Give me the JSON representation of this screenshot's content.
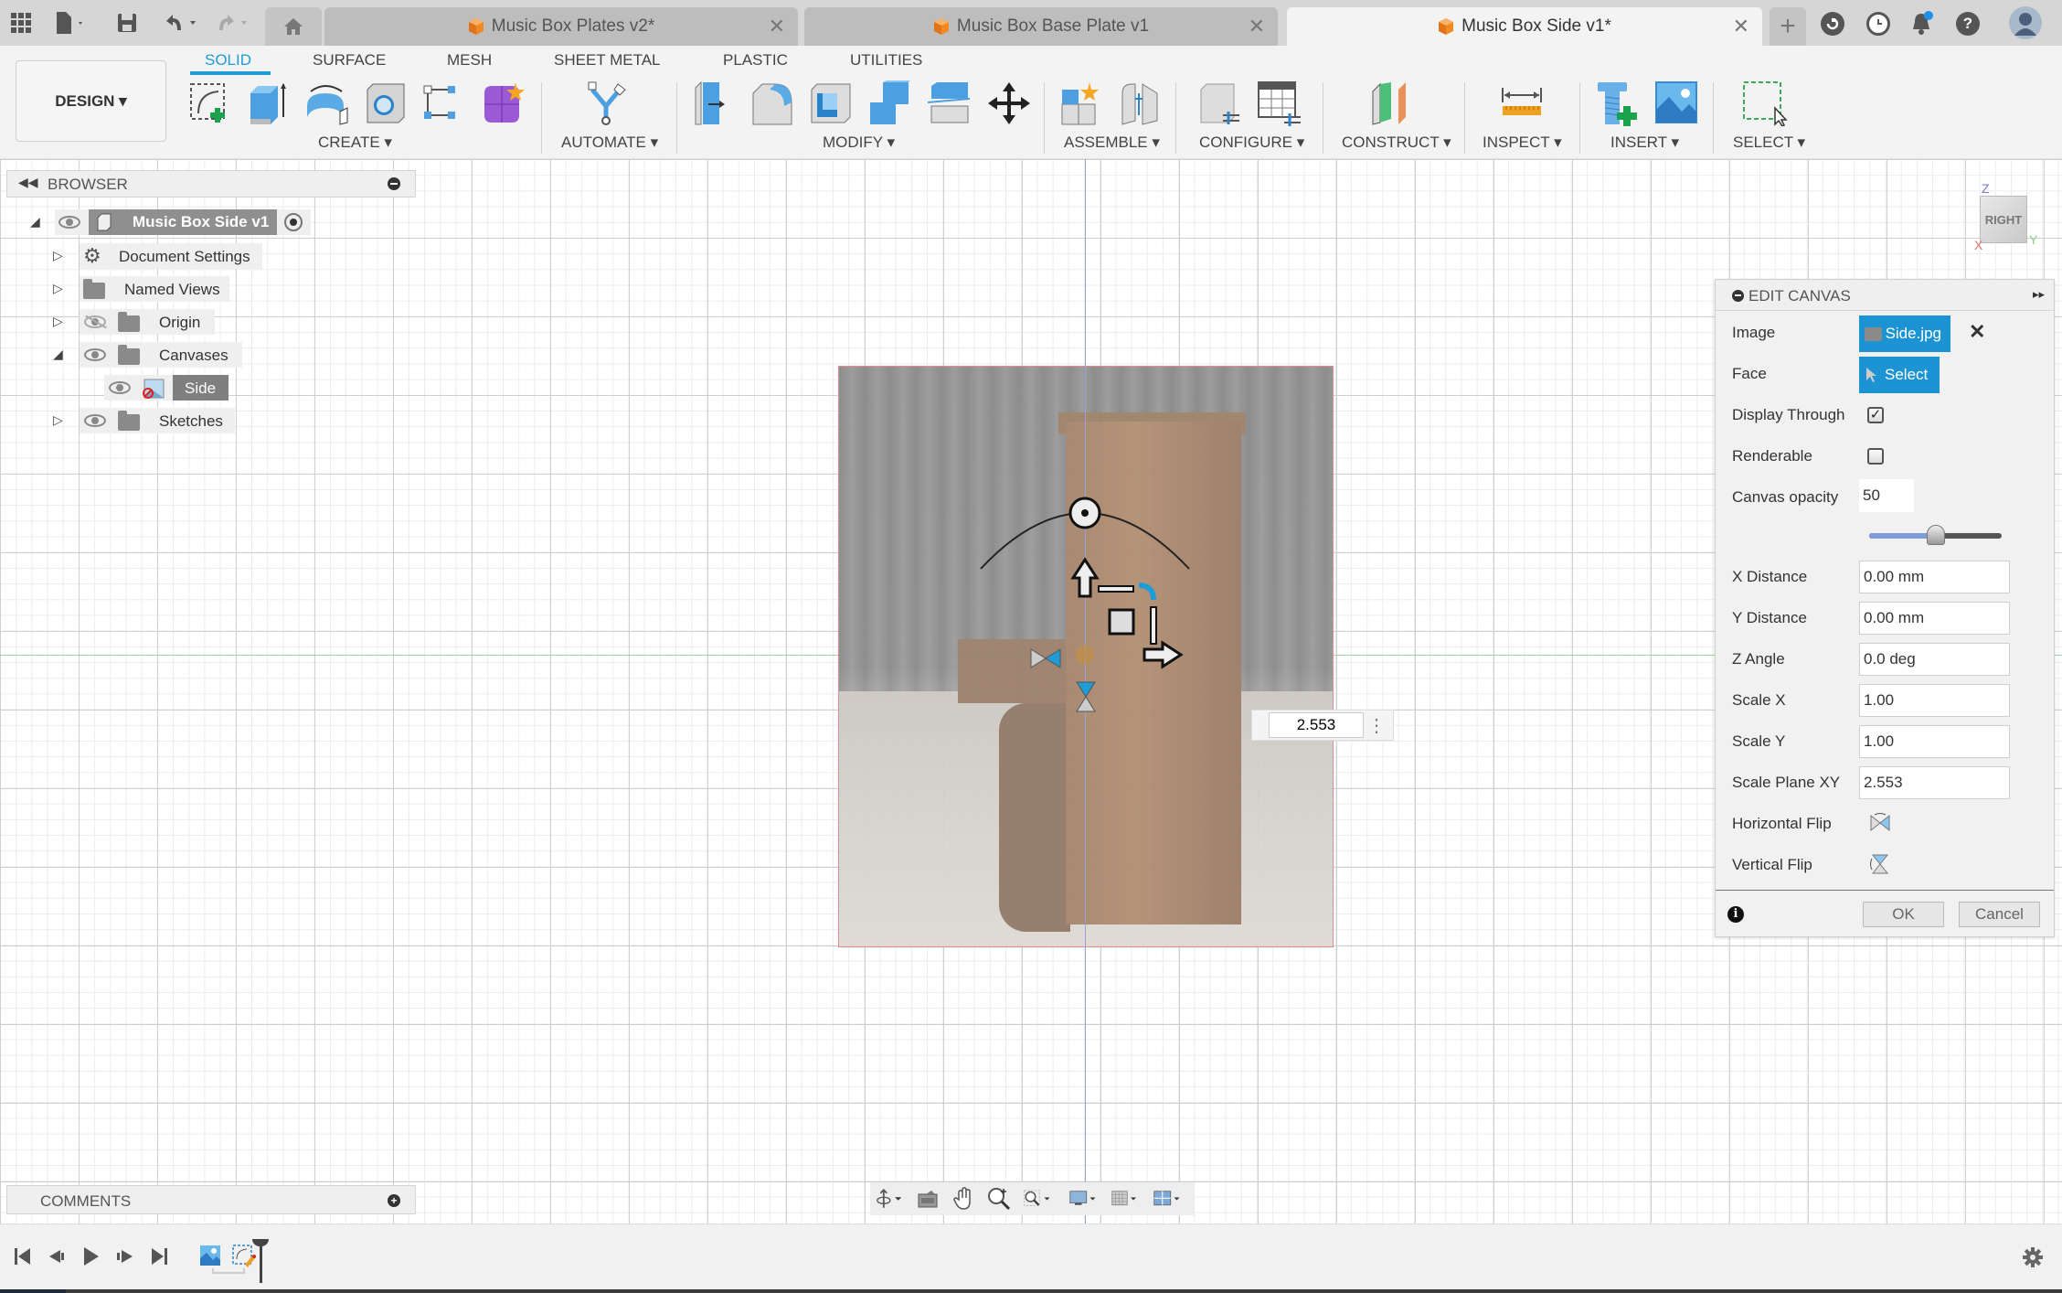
{
  "app_bar": {
    "icons": [
      "apps-grid-icon",
      "file-icon",
      "save-icon",
      "undo-icon",
      "redo-icon",
      "home-icon"
    ],
    "tabs": [
      {
        "label": "Music Box Plates v2*",
        "active": false
      },
      {
        "label": "Music Box Base Plate v1",
        "active": false
      },
      {
        "label": "Music Box Side v1*",
        "active": true
      }
    ],
    "close_glyph": "✕",
    "new_tab_glyph": "+",
    "right_icons": [
      "extensions-icon",
      "job-status-icon",
      "notifications-icon",
      "help-icon",
      "profile-avatar"
    ],
    "help_glyph": "?"
  },
  "toolbar": {
    "workspace_button": "DESIGN ▾",
    "workspace_tabs": [
      "SOLID",
      "SURFACE",
      "MESH",
      "SHEET METAL",
      "PLASTIC",
      "UTILITIES"
    ],
    "active_workspace_tab": "SOLID",
    "groups": [
      {
        "label": "CREATE ▾",
        "tools": [
          "create-sketch",
          "extrude",
          "revolve",
          "hole",
          "pattern",
          "create-form"
        ]
      },
      {
        "label": "AUTOMATE ▾",
        "tools": [
          "automate"
        ]
      },
      {
        "label": "MODIFY ▾",
        "tools": [
          "press-pull",
          "fillet",
          "shell",
          "combine",
          "split-body",
          "move-copy"
        ]
      },
      {
        "label": "ASSEMBLE ▾",
        "tools": [
          "new-component",
          "joint"
        ]
      },
      {
        "label": "CONFIGURE ▾",
        "tools": [
          "configure",
          "configuration-table"
        ]
      },
      {
        "label": "CONSTRUCT ▾",
        "tools": [
          "offset-plane"
        ]
      },
      {
        "label": "INSPECT ▾",
        "tools": [
          "measure"
        ]
      },
      {
        "label": "INSERT ▾",
        "tools": [
          "insert-mcmaster",
          "insert-canvas"
        ]
      },
      {
        "label": "SELECT ▾",
        "tools": [
          "window-select"
        ]
      }
    ]
  },
  "browser": {
    "title": "BROWSER",
    "root": "Music Box Side v1",
    "items": [
      {
        "label": "Document Settings",
        "icon": "gear-icon",
        "expanded": false
      },
      {
        "label": "Named Views",
        "icon": "folder-icon",
        "expanded": false
      },
      {
        "label": "Origin",
        "icon": "folder-icon",
        "visible": false,
        "expanded": false
      },
      {
        "label": "Canvases",
        "icon": "folder-icon",
        "visible": true,
        "expanded": true
      },
      {
        "label": "Side",
        "icon": "canvas-image-icon",
        "visible": true,
        "selected": true
      },
      {
        "label": "Sketches",
        "icon": "folder-icon",
        "visible": true,
        "expanded": false
      }
    ]
  },
  "viewcube": {
    "face": "RIGHT",
    "z": "Z",
    "x": "X",
    "y": "Y"
  },
  "canvas": {
    "scale_input_value": "2.553",
    "more_glyph": "⋮"
  },
  "edit_canvas": {
    "title": "EDIT CANVAS",
    "expand_glyph": "▸▸",
    "image_label": "Image",
    "image_value": "Side.jpg",
    "image_clear_glyph": "✕",
    "face_label": "Face",
    "face_button": "Select",
    "display_through_label": "Display Through",
    "display_through_checked": true,
    "renderable_label": "Renderable",
    "renderable_checked": false,
    "opacity_label": "Canvas opacity",
    "opacity_value": "50",
    "opacity_percent": 50,
    "x_distance_label": "X Distance",
    "x_distance": "0.00 mm",
    "y_distance_label": "Y Distance",
    "y_distance": "0.00 mm",
    "z_angle_label": "Z Angle",
    "z_angle": "0.0 deg",
    "scale_x_label": "Scale X",
    "scale_x": "1.00",
    "scale_y_label": "Scale Y",
    "scale_y": "1.00",
    "scale_plane_label": "Scale Plane XY",
    "scale_plane": "2.553",
    "horizontal_flip_label": "Horizontal Flip",
    "vertical_flip_label": "Vertical Flip",
    "info_glyph": "i",
    "ok_label": "OK",
    "cancel_label": "Cancel"
  },
  "comments": {
    "title": "COMMENTS",
    "add_glyph": "+"
  },
  "navbar": {
    "icons": [
      "orbit-icon",
      "look-at-icon",
      "pan-icon",
      "zoom-icon",
      "fit-icon",
      "display-settings-icon",
      "grid-settings-icon",
      "viewports-icon"
    ]
  },
  "timeline": {
    "controls": [
      "first-icon",
      "previous-icon",
      "play-icon",
      "next-icon",
      "last-icon"
    ],
    "features": [
      "canvas-feature",
      "sketch-feature"
    ],
    "settings_icon": "gear-icon"
  }
}
